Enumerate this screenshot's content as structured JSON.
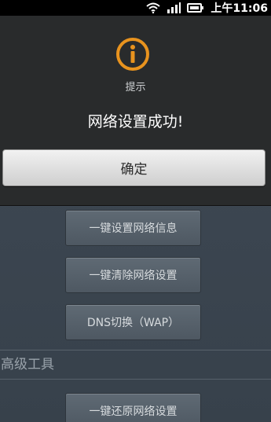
{
  "status_bar": {
    "time": "上午11:06",
    "icons": [
      "wifi-icon",
      "signal-icon",
      "battery-icon"
    ]
  },
  "dialog": {
    "icon": "info-icon",
    "title": "提示",
    "message": "网络设置成功!",
    "confirm_label": "确定"
  },
  "background": {
    "buttons": [
      {
        "label": "一键设置网络信息"
      },
      {
        "label": "一键清除网络设置"
      },
      {
        "label": "DNS切换（WAP）"
      }
    ],
    "section_title": "高级工具",
    "section_buttons": [
      {
        "label": "一键还原网络设置"
      }
    ]
  },
  "colors": {
    "accent_orange": "#e8931e",
    "dialog_bg": "#292b2c",
    "app_bg": "#3c4651"
  }
}
